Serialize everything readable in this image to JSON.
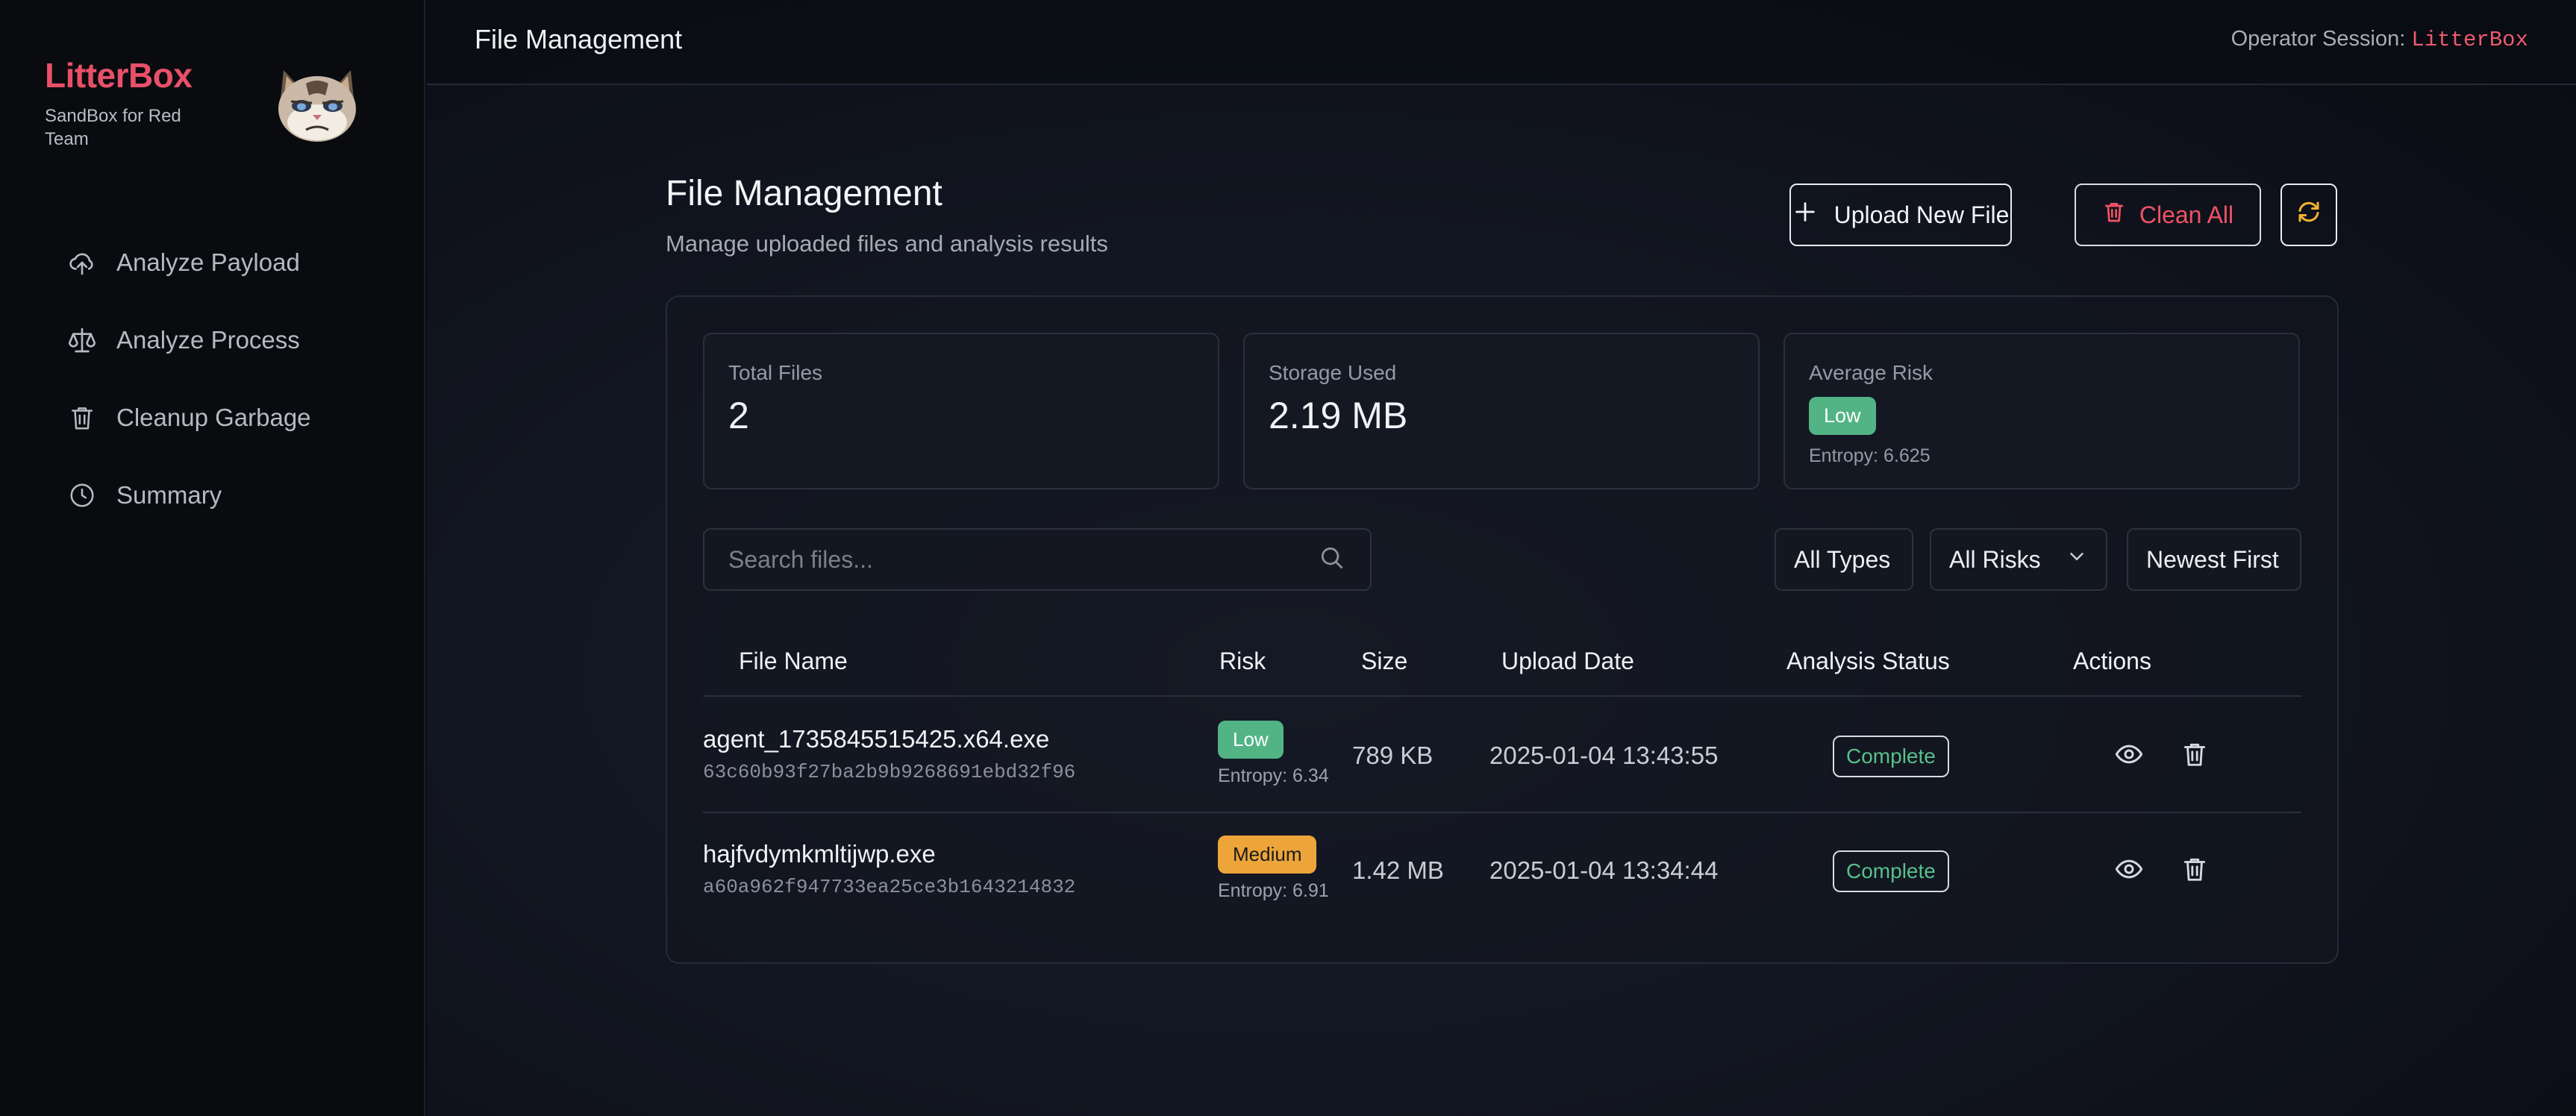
{
  "sidebar": {
    "brand_title": "LitterBox",
    "brand_subtitle": "SandBox for Red Team",
    "logo_icon": "grumpy-cat-logo",
    "items": [
      {
        "label": "Analyze Payload",
        "icon": "upload-cloud-icon"
      },
      {
        "label": "Analyze Process",
        "icon": "scale-icon"
      },
      {
        "label": "Cleanup Garbage",
        "icon": "trash-icon"
      },
      {
        "label": "Summary",
        "icon": "clock-icon"
      }
    ]
  },
  "topbar": {
    "title": "File Management",
    "session_label": "Operator Session:",
    "session_user": "LitterBox"
  },
  "page": {
    "title": "File Management",
    "subtitle": "Manage uploaded files and analysis results"
  },
  "toolbar": {
    "upload_label": "Upload New File",
    "clean_label": "Clean All",
    "refresh_icon": "refresh-icon"
  },
  "stats": {
    "total_files_label": "Total Files",
    "total_files_value": "2",
    "storage_label": "Storage Used",
    "storage_value": "2.19 MB",
    "avg_risk_label": "Average Risk",
    "avg_risk_badge": "Low",
    "avg_risk_entropy": "Entropy: 6.625"
  },
  "filters": {
    "search_placeholder": "Search files...",
    "types": "All Types",
    "risks": "All Risks",
    "sort": "Newest First"
  },
  "table": {
    "headers": [
      "File Name",
      "Risk",
      "Size",
      "Upload Date",
      "Analysis Status",
      "Actions"
    ],
    "rows": [
      {
        "name": "agent_1735845515425.x64.exe",
        "hash": "63c60b93f27ba2b9b9268691ebd32f96",
        "risk": "Low",
        "entropy": "Entropy: 6.34",
        "size": "789 KB",
        "date": "2025-01-04 13:43:55",
        "status": "Complete"
      },
      {
        "name": "hajfvdymkmltijwp.exe",
        "hash": "a60a962f947733ea25ce3b1643214832",
        "risk": "Medium",
        "entropy": "Entropy: 6.91",
        "size": "1.42 MB",
        "date": "2025-01-04 13:34:44",
        "status": "Complete"
      }
    ]
  },
  "colors": {
    "brand": "#e8506a",
    "low": "#52b485",
    "medium": "#eda53a",
    "danger": "#f05264",
    "refresh": "#f1b233"
  }
}
